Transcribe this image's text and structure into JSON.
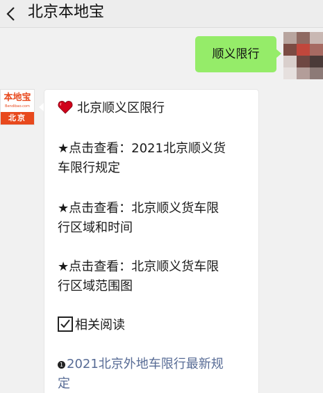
{
  "header": {
    "title": "北京本地宝"
  },
  "user_message": {
    "text": "顺义限行"
  },
  "bot": {
    "logo": {
      "top": "本地宝",
      "sub": "Bendibao.com",
      "bottom": "北京"
    },
    "reply": {
      "heading": "北京顺义区限行",
      "items": [
        {
          "line1": "★点击查看：2021北京顺义货",
          "line2": "车限行规定"
        },
        {
          "line1": "★点击查看：北京顺义货车限",
          "line2": "行区域和时间"
        },
        {
          "line1": "★点击查看：北京顺义货车限",
          "line2": "行区域范围图"
        }
      ],
      "related_label": "相关阅读",
      "related_links": [
        {
          "bullet": "1",
          "line1": "2021北京外地车限行最新规",
          "line2": "定"
        }
      ]
    }
  },
  "colors": {
    "my_bubble": "#95ec69",
    "bot_bubble": "#ffffff",
    "background": "#f1f1f1",
    "link": "#576b95",
    "brand": "#e8491d"
  },
  "icons": {
    "back": "chevron-left-icon",
    "heart": "heart-icon",
    "check": "checkbox-icon"
  }
}
